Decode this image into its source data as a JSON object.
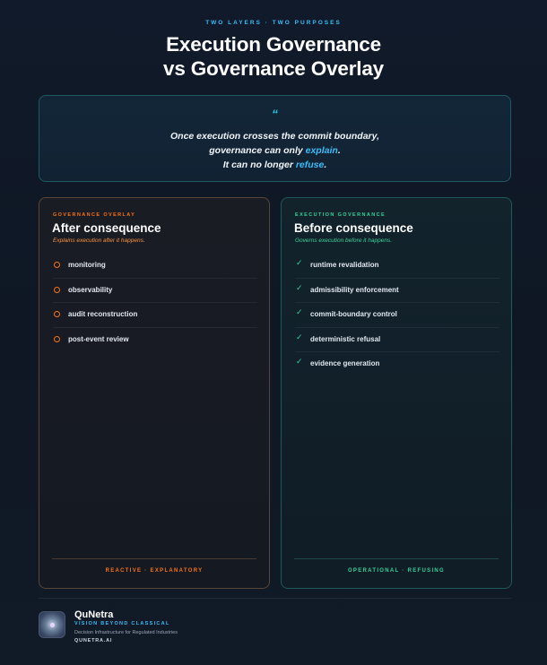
{
  "header": {
    "eyebrow": "TWO LAYERS · TWO PURPOSES",
    "title_line1": "Execution Governance",
    "title_line2": "vs Governance Overlay"
  },
  "quote": {
    "mark": "“",
    "line1": "Once execution crosses the commit boundary,",
    "line2_prefix": "governance can only ",
    "line2_highlight": "explain",
    "line2_suffix": ".",
    "line3_prefix": "It can no longer ",
    "line3_highlight": "refuse",
    "line3_suffix": "."
  },
  "left_card": {
    "eyebrow": "GOVERNANCE OVERLAY",
    "title": "After consequence",
    "subtitle": "Explains execution after it happens.",
    "items": [
      "monitoring",
      "observability",
      "audit reconstruction",
      "post-event review"
    ],
    "footer": "REACTIVE · EXPLANATORY",
    "accent": "#f97316"
  },
  "right_card": {
    "eyebrow": "EXECUTION GOVERNANCE",
    "title": "Before consequence",
    "subtitle": "Governs execution before it happens.",
    "items": [
      "runtime revalidation",
      "admissibility enforcement",
      "commit-boundary control",
      "deterministic refusal",
      "evidence generation"
    ],
    "footer": "OPERATIONAL · REFUSING",
    "accent": "#34d399"
  },
  "footer": {
    "brand": "QuNetra",
    "tagline": "VISION BEYOND CLASSICAL",
    "description": "Decision Infrastructure for Regulated Industries",
    "site": "QUNETRA.AI",
    "logo_icon": "qunetra-logo-icon"
  }
}
